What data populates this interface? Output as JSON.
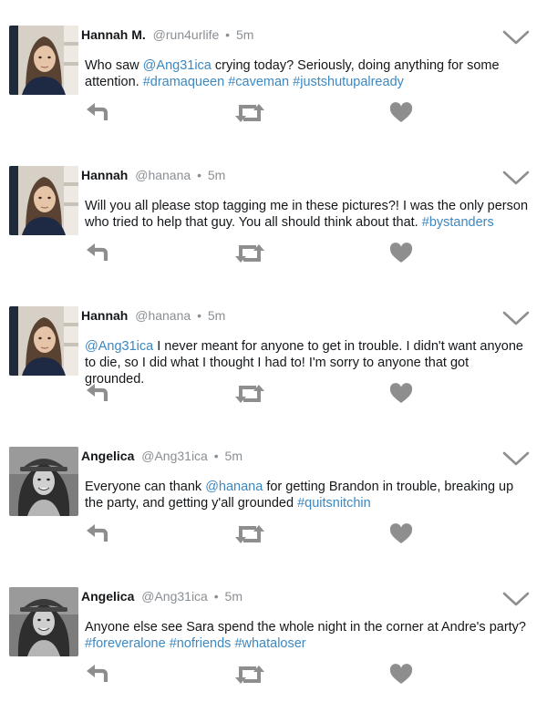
{
  "tweets": [
    {
      "name": "Hannah M.",
      "handle": "@run4urlife",
      "time": "5m",
      "avatar": "hannah-photo",
      "segments": [
        {
          "text": "Who saw ",
          "link": false
        },
        {
          "text": "@Ang31ica",
          "link": true
        },
        {
          "text": " crying today? Seriously, doing anything for some attention. ",
          "link": false
        },
        {
          "text": "#dramaqueen",
          "link": true
        },
        {
          "text": " ",
          "link": false
        },
        {
          "text": "#caveman",
          "link": true
        },
        {
          "text": " ",
          "link": false
        },
        {
          "text": "#justshutupalready",
          "link": true
        }
      ]
    },
    {
      "name": "Hannah",
      "handle": "@hanana",
      "time": "5m",
      "avatar": "hannah-photo",
      "segments": [
        {
          "text": "Will you all please stop tagging me in these pictures?! I was the only person who tried to help that guy. You all should think about that. ",
          "link": false
        },
        {
          "text": "#bystanders",
          "link": true
        }
      ]
    },
    {
      "name": "Hannah",
      "handle": "@hanana",
      "time": "5m",
      "avatar": "hannah-photo",
      "segments": [
        {
          "text": "@Ang31ica",
          "link": true
        },
        {
          "text": " I never meant for anyone to get in trouble. I didn't want anyone to die, so I did what I thought I had to! I'm sorry to anyone that got grounded.",
          "link": false
        }
      ]
    },
    {
      "name": "Angelica",
      "handle": "@Ang31ica",
      "time": "5m",
      "avatar": "angelica-photo",
      "segments": [
        {
          "text": "Everyone can thank ",
          "link": false
        },
        {
          "text": "@hanana",
          "link": true
        },
        {
          "text": " for getting Brandon in trouble, breaking up the party, and getting y'all grounded ",
          "link": false
        },
        {
          "text": "#quitsnitchin",
          "link": true
        }
      ]
    },
    {
      "name": "Angelica",
      "handle": "@Ang31ica",
      "time": "5m",
      "avatar": "angelica-photo",
      "segments": [
        {
          "text": "Anyone else see Sara spend the whole night in the corner at Andre's party? ",
          "link": false
        },
        {
          "text": "#foreveralone",
          "link": true
        },
        {
          "text": " ",
          "link": false
        },
        {
          "text": "#nofriends",
          "link": true
        },
        {
          "text": " ",
          "link": false
        },
        {
          "text": "#whataloser",
          "link": true
        }
      ]
    }
  ],
  "separator": "•",
  "colors": {
    "link": "#3b88c3",
    "icon": "#8e8e8e",
    "meta": "#8a8f94",
    "text": "#14171a"
  },
  "icons": {
    "reply": "reply-icon",
    "retweet": "retweet-icon",
    "like": "heart-icon",
    "menu": "chevron-down-icon"
  }
}
